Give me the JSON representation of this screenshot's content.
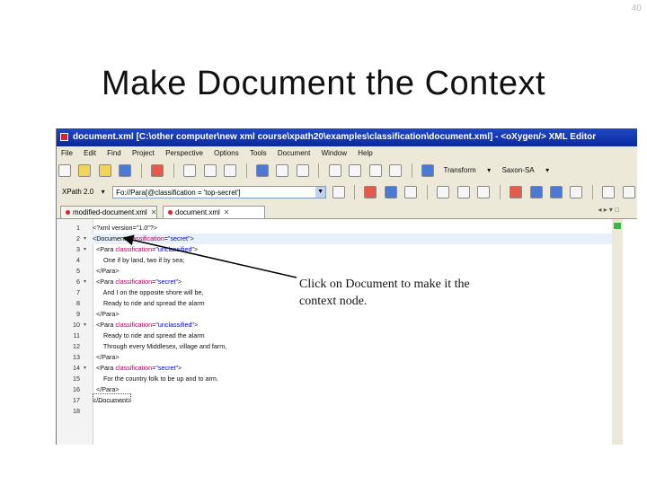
{
  "slide": {
    "number": "40",
    "title": "Make Document the Context",
    "callout": "Click on Document to make it the context node."
  },
  "window": {
    "title": "document.xml [C:\\other computer\\new xml course\\xpath20\\examples\\classification\\document.xml] - <oXygen/> XML Editor"
  },
  "menu": [
    "File",
    "Edit",
    "Find",
    "Project",
    "Perspective",
    "Options",
    "Tools",
    "Document",
    "Window",
    "Help"
  ],
  "toolbar": {
    "transform_label": "Transform",
    "xpath_version": "XPath 2.0",
    "xpath_value": "Fo://Para[@classification = 'top-secret']",
    "schema_label": "Saxon-SA"
  },
  "tabs": [
    {
      "label": "modified-document.xml"
    },
    {
      "label": "document.xml"
    }
  ],
  "editor": {
    "lines": [
      {
        "n": "1",
        "parts": [
          {
            "c": "tag",
            "t": "<?xml version=\"1.0\"?>"
          }
        ]
      },
      {
        "n": "2",
        "parts": [
          {
            "c": "tag",
            "t": "<Document "
          },
          {
            "c": "attr",
            "t": "classification"
          },
          {
            "c": "tag",
            "t": "="
          },
          {
            "c": "val",
            "t": "\"secret\""
          },
          {
            "c": "tag",
            "t": ">"
          }
        ]
      },
      {
        "n": "3",
        "parts": [
          {
            "c": "tag",
            "t": "  <Para "
          },
          {
            "c": "attr",
            "t": "classification"
          },
          {
            "c": "tag",
            "t": "="
          },
          {
            "c": "val",
            "t": "\"unclassified\""
          },
          {
            "c": "tag",
            "t": ">"
          }
        ]
      },
      {
        "n": "4",
        "parts": [
          {
            "c": "txt",
            "t": "      One if by land, two if by sea;"
          }
        ]
      },
      {
        "n": "5",
        "parts": [
          {
            "c": "tag",
            "t": "  </Para>"
          }
        ]
      },
      {
        "n": "6",
        "parts": [
          {
            "c": "tag",
            "t": "  <Para "
          },
          {
            "c": "attr",
            "t": "classification"
          },
          {
            "c": "tag",
            "t": "="
          },
          {
            "c": "val",
            "t": "\"secret\""
          },
          {
            "c": "tag",
            "t": ">"
          }
        ]
      },
      {
        "n": "7",
        "parts": [
          {
            "c": "txt",
            "t": "      And I on the opposite shore will be,"
          }
        ]
      },
      {
        "n": "8",
        "parts": [
          {
            "c": "txt",
            "t": "      Ready to ride and spread the alarm"
          }
        ]
      },
      {
        "n": "9",
        "parts": [
          {
            "c": "tag",
            "t": "  </Para>"
          }
        ]
      },
      {
        "n": "10",
        "parts": [
          {
            "c": "tag",
            "t": "  <Para "
          },
          {
            "c": "attr",
            "t": "classification"
          },
          {
            "c": "tag",
            "t": "="
          },
          {
            "c": "val",
            "t": "\"unclassified\""
          },
          {
            "c": "tag",
            "t": ">"
          }
        ]
      },
      {
        "n": "11",
        "parts": [
          {
            "c": "txt",
            "t": "      Ready to ride and spread the alarm"
          }
        ]
      },
      {
        "n": "12",
        "parts": [
          {
            "c": "txt",
            "t": "      Through every Middlesex, village and farm,"
          }
        ]
      },
      {
        "n": "13",
        "parts": [
          {
            "c": "tag",
            "t": "  </Para>"
          }
        ]
      },
      {
        "n": "14",
        "parts": [
          {
            "c": "tag",
            "t": "  <Para "
          },
          {
            "c": "attr",
            "t": "classification"
          },
          {
            "c": "tag",
            "t": "="
          },
          {
            "c": "val",
            "t": "\"secret\""
          },
          {
            "c": "tag",
            "t": ">"
          }
        ]
      },
      {
        "n": "15",
        "parts": [
          {
            "c": "txt",
            "t": "      For the country folk to be up and to arm."
          }
        ]
      },
      {
        "n": "16",
        "parts": [
          {
            "c": "tag",
            "t": "  </Para>"
          }
        ]
      },
      {
        "n": "17",
        "parts": [
          {
            "c": "tag",
            "t": "</Document>"
          }
        ]
      },
      {
        "n": "18",
        "parts": []
      }
    ]
  }
}
